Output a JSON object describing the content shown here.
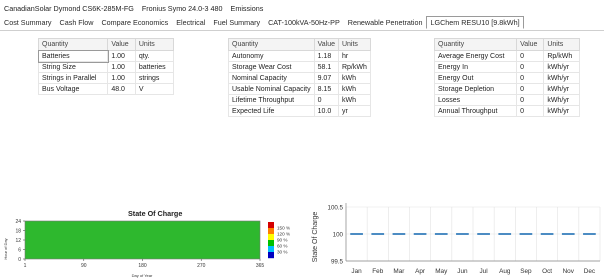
{
  "header": {
    "components": [
      "CanadianSolar Dymond CS6K-285M-FG",
      "Fronius Symo 24.0-3 480",
      "Emissions"
    ]
  },
  "tabs": [
    {
      "label": "Cost Summary",
      "active": false
    },
    {
      "label": "Cash Flow",
      "active": false
    },
    {
      "label": "Compare Economics",
      "active": false
    },
    {
      "label": "Electrical",
      "active": false
    },
    {
      "label": "Fuel Summary",
      "active": false
    },
    {
      "label": "CAT-100kVA-50Hz-PP",
      "active": false
    },
    {
      "label": "Renewable Penetration",
      "active": false
    },
    {
      "label": "LGChem RESU10 [9.8kWh]",
      "active": true
    }
  ],
  "tables": {
    "headers": {
      "quantity": "Quantity",
      "value": "Value",
      "units": "Units"
    },
    "left": [
      {
        "q": "Batteries",
        "v": "1.00",
        "u": "qty."
      },
      {
        "q": "String Size",
        "v": "1.00",
        "u": "batteries"
      },
      {
        "q": "Strings in Parallel",
        "v": "1.00",
        "u": "strings"
      },
      {
        "q": "Bus Voltage",
        "v": "48.0",
        "u": "V"
      }
    ],
    "middle": [
      {
        "q": "Autonomy",
        "v": "1.18",
        "u": "hr"
      },
      {
        "q": "Storage Wear Cost",
        "v": "58.1",
        "u": "Rp/kWh"
      },
      {
        "q": "Nominal Capacity",
        "v": "9.07",
        "u": "kWh"
      },
      {
        "q": "Usable Nominal Capacity",
        "v": "8.15",
        "u": "kWh"
      },
      {
        "q": "Lifetime Throughput",
        "v": "0",
        "u": "kWh"
      },
      {
        "q": "Expected Life",
        "v": "10.0",
        "u": "yr"
      }
    ],
    "right": [
      {
        "q": "Average Energy Cost",
        "v": "0",
        "u": "Rp/kWh"
      },
      {
        "q": "Energy In",
        "v": "0",
        "u": "kWh/yr"
      },
      {
        "q": "Energy Out",
        "v": "0",
        "u": "kWh/yr"
      },
      {
        "q": "Storage Depletion",
        "v": "0",
        "u": "kWh/yr"
      },
      {
        "q": "Losses",
        "v": "0",
        "u": "kWh/yr"
      },
      {
        "q": "Annual Throughput",
        "v": "0",
        "u": "kWh/yr"
      }
    ]
  },
  "soc_chart": {
    "title": "State Of Charge",
    "ylabel": "Hour of Day",
    "xlabel": "Day of Year",
    "yticks": [
      "24",
      "18",
      "12",
      "6",
      "0"
    ],
    "xticks": [
      "1",
      "90",
      "180",
      "270",
      "365"
    ],
    "fill_color": "#2eb82e",
    "legend": [
      "150 %",
      "120 %",
      "90 %",
      "60 %",
      "30 %"
    ],
    "legend_colors": [
      "#d40000",
      "#ff7f00",
      "#ffff00",
      "#00c000",
      "#00c0ff",
      "#0000c0"
    ]
  },
  "chart_data": {
    "type": "line",
    "title": "",
    "ylabel": "State Of Charge",
    "xlabel": "",
    "categories": [
      "Jan",
      "Feb",
      "Mar",
      "Apr",
      "May",
      "Jun",
      "Jul",
      "Aug",
      "Sep",
      "Oct",
      "Nov",
      "Dec"
    ],
    "yticks": [
      "100.5",
      "100",
      "99.5"
    ],
    "ylim": [
      99.5,
      100.5
    ],
    "series": [
      {
        "values": [
          100,
          100,
          100,
          100,
          100,
          100,
          100,
          100,
          100,
          100,
          100,
          100
        ]
      }
    ],
    "color": "#1f6fb4",
    "grid": true
  }
}
